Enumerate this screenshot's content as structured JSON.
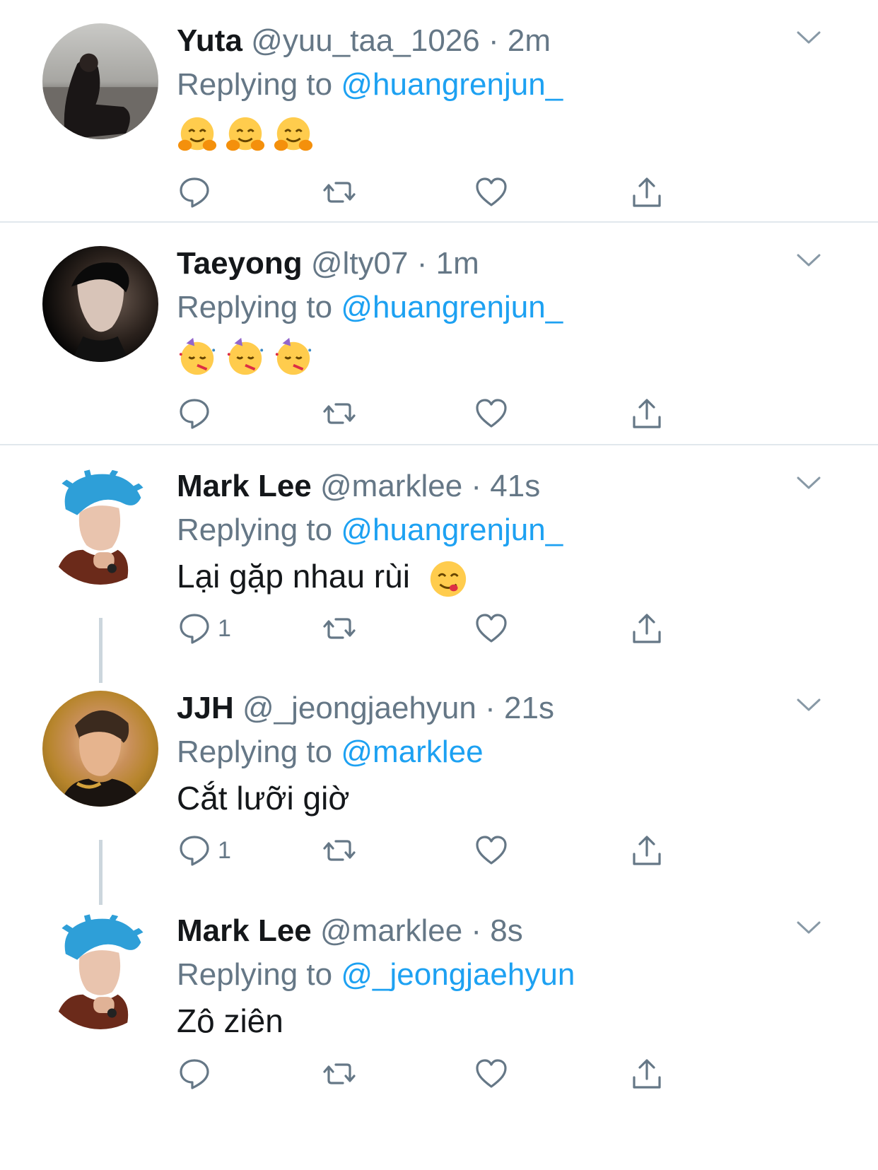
{
  "tweets": [
    {
      "name": "Yuta",
      "handle": "@yuu_taa_1026",
      "time": "2m",
      "reply_prefix": "Replying to",
      "reply_to": "@huangrenjun_",
      "text": "",
      "emojis": [
        "hugging-face",
        "hugging-face",
        "hugging-face"
      ],
      "reply_count": ""
    },
    {
      "name": "Taeyong",
      "handle": "@lty07",
      "time": "1m",
      "reply_prefix": "Replying to",
      "reply_to": "@huangrenjun_",
      "text": "",
      "emojis": [
        "partying-face",
        "partying-face",
        "partying-face"
      ],
      "reply_count": ""
    },
    {
      "name": "Mark Lee",
      "handle": "@marklee",
      "time": "41s",
      "reply_prefix": "Replying to",
      "reply_to": "@huangrenjun_",
      "text": "Lại gặp nhau rùi",
      "emojis": [
        "yum-face"
      ],
      "reply_count": "1"
    },
    {
      "name": "JJH",
      "handle": "@_jeongjaehyun",
      "time": "21s",
      "reply_prefix": "Replying to",
      "reply_to": "@marklee",
      "text": "Cắt lưỡi giờ",
      "emojis": [],
      "reply_count": "1"
    },
    {
      "name": "Mark Lee",
      "handle": "@marklee",
      "time": "8s",
      "reply_prefix": "Replying to",
      "reply_to": "@_jeongjaehyun",
      "text": "Zô ziên",
      "emojis": [],
      "reply_count": ""
    }
  ],
  "icons": {
    "reply": "reply-bubble-icon",
    "retweet": "retweet-icon",
    "like": "heart-icon",
    "share": "share-icon",
    "menu": "chevron-down-icon"
  },
  "colors": {
    "text": "#14171a",
    "secondary": "#657786",
    "link": "#1da1f2",
    "divider": "#e1e8ed"
  }
}
